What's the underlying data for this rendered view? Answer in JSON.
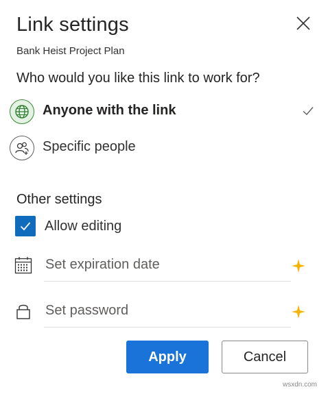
{
  "dialog": {
    "title": "Link settings",
    "file_name": "Bank Heist Project Plan",
    "question": "Who would you like this link to work for?",
    "close_icon": "close-icon"
  },
  "audience_options": [
    {
      "label": "Anyone with the link",
      "icon": "globe-icon",
      "selected": true
    },
    {
      "label": "Specific people",
      "icon": "people-icon",
      "selected": false
    }
  ],
  "other_settings": {
    "heading": "Other settings",
    "allow_editing": {
      "label": "Allow editing",
      "checked": true
    },
    "expiration": {
      "placeholder": "Set expiration date",
      "icon": "calendar-icon",
      "premium_icon": "premium-diamond-icon"
    },
    "password": {
      "placeholder": "Set password",
      "icon": "lock-icon",
      "premium_icon": "premium-diamond-icon"
    }
  },
  "actions": {
    "apply_label": "Apply",
    "cancel_label": "Cancel"
  },
  "watermark": "wsxdn.com",
  "colors": {
    "accent": "#1a73d9",
    "checkbox": "#0f6cbd",
    "globe_green": "#3a8a3a",
    "premium_gold": "#f5b400"
  }
}
